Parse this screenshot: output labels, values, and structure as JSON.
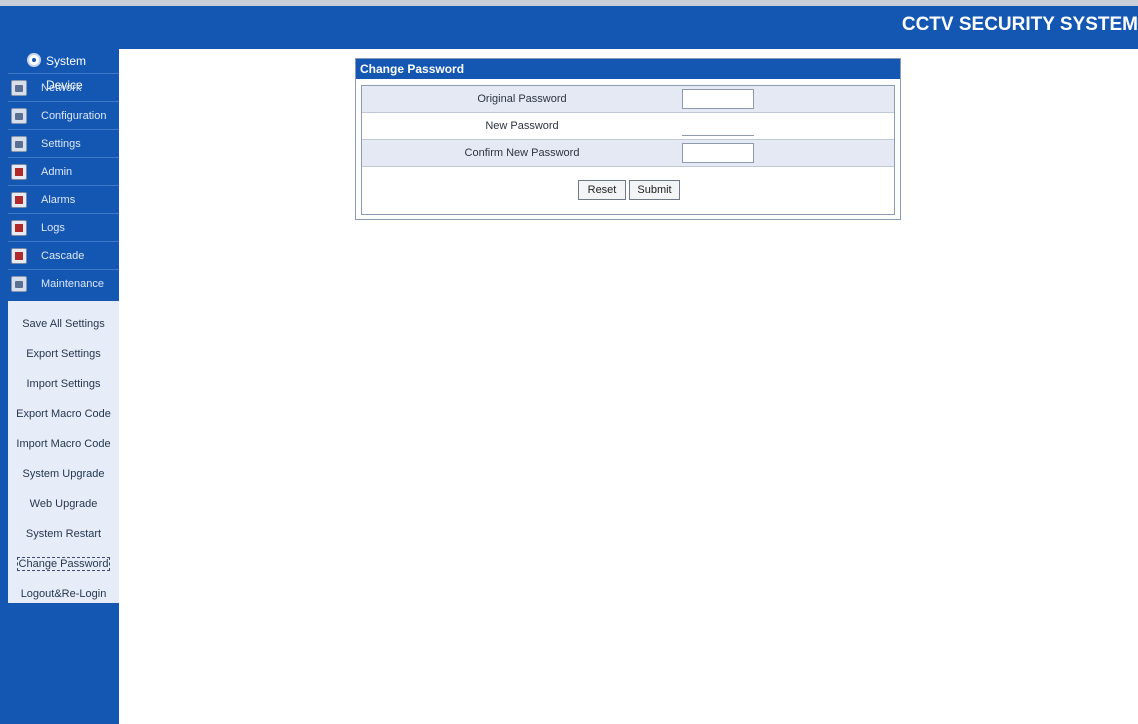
{
  "header": {
    "title": "CCTV SECURITY SYSTEM"
  },
  "sidebar": {
    "root_label": "System Device",
    "categories": [
      {
        "label": "Network",
        "icon": "network-icon"
      },
      {
        "label": "Configuration",
        "icon": "configuration-icon"
      },
      {
        "label": "Settings",
        "icon": "settings-icon"
      },
      {
        "label": "Admin",
        "icon": "admin-icon"
      },
      {
        "label": "Alarms",
        "icon": "alarms-icon"
      },
      {
        "label": "Logs",
        "icon": "logs-icon"
      },
      {
        "label": "Cascade",
        "icon": "cascade-icon"
      },
      {
        "label": "Maintenance",
        "icon": "maintenance-icon"
      }
    ],
    "maintenance_items": [
      {
        "label": "Save All Settings"
      },
      {
        "label": "Export Settings"
      },
      {
        "label": "Import Settings"
      },
      {
        "label": "Export Macro Code"
      },
      {
        "label": "Import Macro Code"
      },
      {
        "label": "System Upgrade"
      },
      {
        "label": "Web Upgrade"
      },
      {
        "label": "System Restart"
      },
      {
        "label": "Change Password"
      },
      {
        "label": "Logout&Re-Login"
      }
    ],
    "active_item": "Change Password"
  },
  "panel": {
    "title": "Change Password",
    "fields": [
      {
        "label": "Original Password",
        "value": ""
      },
      {
        "label": "New Password",
        "value": ""
      },
      {
        "label": "Confirm New Password",
        "value": ""
      }
    ],
    "buttons": {
      "reset": "Reset",
      "submit": "Submit"
    }
  },
  "colors": {
    "brand_blue": "#1357b3",
    "panel_row_shade": "#e4e9f3"
  }
}
